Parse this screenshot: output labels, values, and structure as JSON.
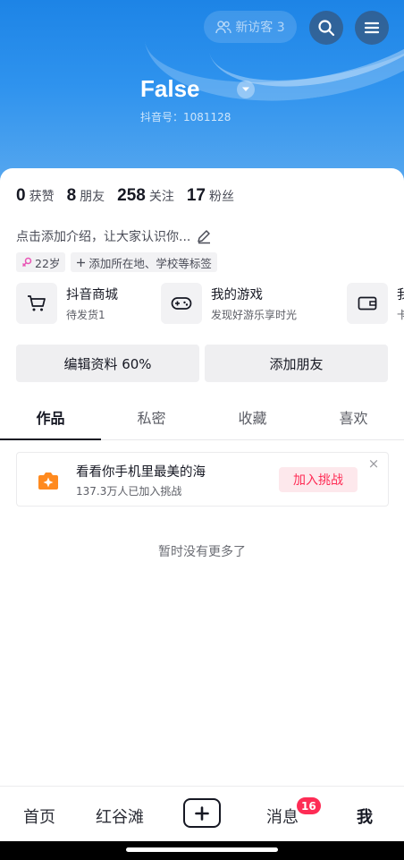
{
  "header": {
    "visitor_label": "新访客 3",
    "username": "False",
    "douyin_id": "抖音号：1081128"
  },
  "stats": [
    {
      "num": "0",
      "label": "获赞"
    },
    {
      "num": "8",
      "label": "朋友"
    },
    {
      "num": "258",
      "label": "关注"
    },
    {
      "num": "17",
      "label": "粉丝"
    }
  ],
  "bio": "点击添加介绍，让大家认识你...",
  "tags": {
    "age": "22岁",
    "add": "添加所在地、学校等标签"
  },
  "services": [
    {
      "title": "抖音商城",
      "subtitle": "待发货1",
      "icon": "cart-icon"
    },
    {
      "title": "我的游戏",
      "subtitle": "发现好游乐享时光",
      "icon": "gamepad-icon"
    },
    {
      "title": "我",
      "subtitle": "卡",
      "icon": "wallet-icon"
    }
  ],
  "actions": {
    "edit": "编辑资料 60%",
    "add_friend": "添加朋友"
  },
  "tabs": [
    "作品",
    "私密",
    "收藏",
    "喜欢"
  ],
  "challenge": {
    "title": "看看你手机里最美的海",
    "subtitle": "137.3万人已加入挑战",
    "join": "加入挑战",
    "close": "×"
  },
  "empty_note": "暂时没有更多了",
  "nav": {
    "home": "首页",
    "second": "红谷滩",
    "messages": "消息",
    "messages_badge": "16",
    "me": "我"
  },
  "colors": {
    "accent": "#fe2c55",
    "header_blue": "#2f93ee"
  }
}
